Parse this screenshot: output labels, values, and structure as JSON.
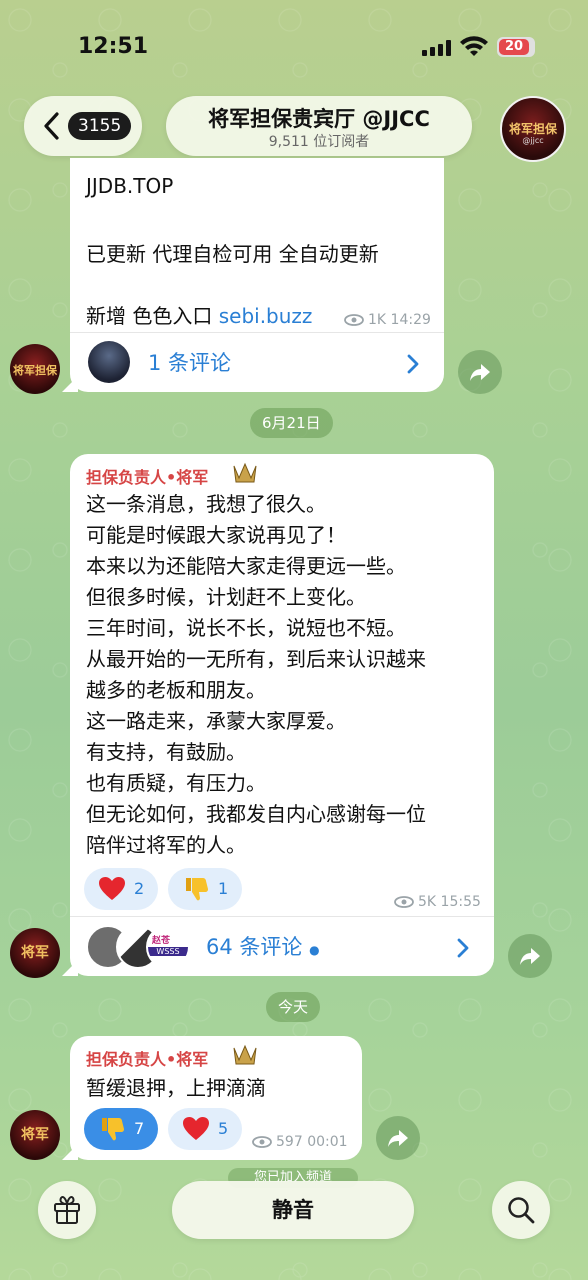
{
  "status": {
    "time": "12:51",
    "battery": "20"
  },
  "header": {
    "back_count": "3155",
    "title": "将军担保贵宾厅 @JJCC",
    "subscribers": "9,511 位订阅者",
    "avatar_text": "将军担保",
    "avatar_sub": "@jjcc"
  },
  "msg1": {
    "line1": "JJDB.TOP",
    "line2": "已更新 代理自检可用 全自动更新",
    "line3_prefix": "新增 色色入口",
    "line3_link": "sebi.buzz",
    "views": "1K",
    "time": "14:29",
    "comments": "1 条评论"
  },
  "date1": "6月21日",
  "msg2": {
    "sender": "担保负责人•将军",
    "lines": [
      "这一条消息，我想了很久。",
      "可能是时候跟大家说再见了！",
      "本来以为还能陪大家走得更远一些。",
      "但很多时候，计划赶不上变化。",
      "三年时间，说长不长，说短也不短。",
      "从最开始的一无所有，到后来认识越来",
      "越多的老板和朋友。",
      "这一路走来，承蒙大家厚爱。",
      "有支持，有鼓励。",
      "也有质疑，有压力。",
      "但无论如何，我都发自内心感谢每一位",
      "陪伴过将军的人。"
    ],
    "reactions": [
      {
        "emoji": "heart",
        "count": "2"
      },
      {
        "emoji": "thumbs-down",
        "count": "1"
      }
    ],
    "views": "5K",
    "time": "15:55",
    "comments": "64 条评论",
    "mini_avatar_text": "赵苍",
    "mini_avatar_sub": "WSSS"
  },
  "date2": "今天",
  "msg3": {
    "sender": "担保负责人•将军",
    "text": "暂缓退押，上押滴滴",
    "reactions": [
      {
        "emoji": "thumbs-down",
        "count": "7"
      },
      {
        "emoji": "heart",
        "count": "5"
      }
    ],
    "views": "597",
    "time": "00:01"
  },
  "avatar_text_small": "将军",
  "avatar_text_small_2": "将军担保",
  "joined_text": "您已加入频道",
  "bottom": {
    "mute": "静音"
  },
  "colors": {
    "link": "#2a7fd4",
    "sender": "#d64545",
    "reaction_active": "#3a8ee6"
  }
}
